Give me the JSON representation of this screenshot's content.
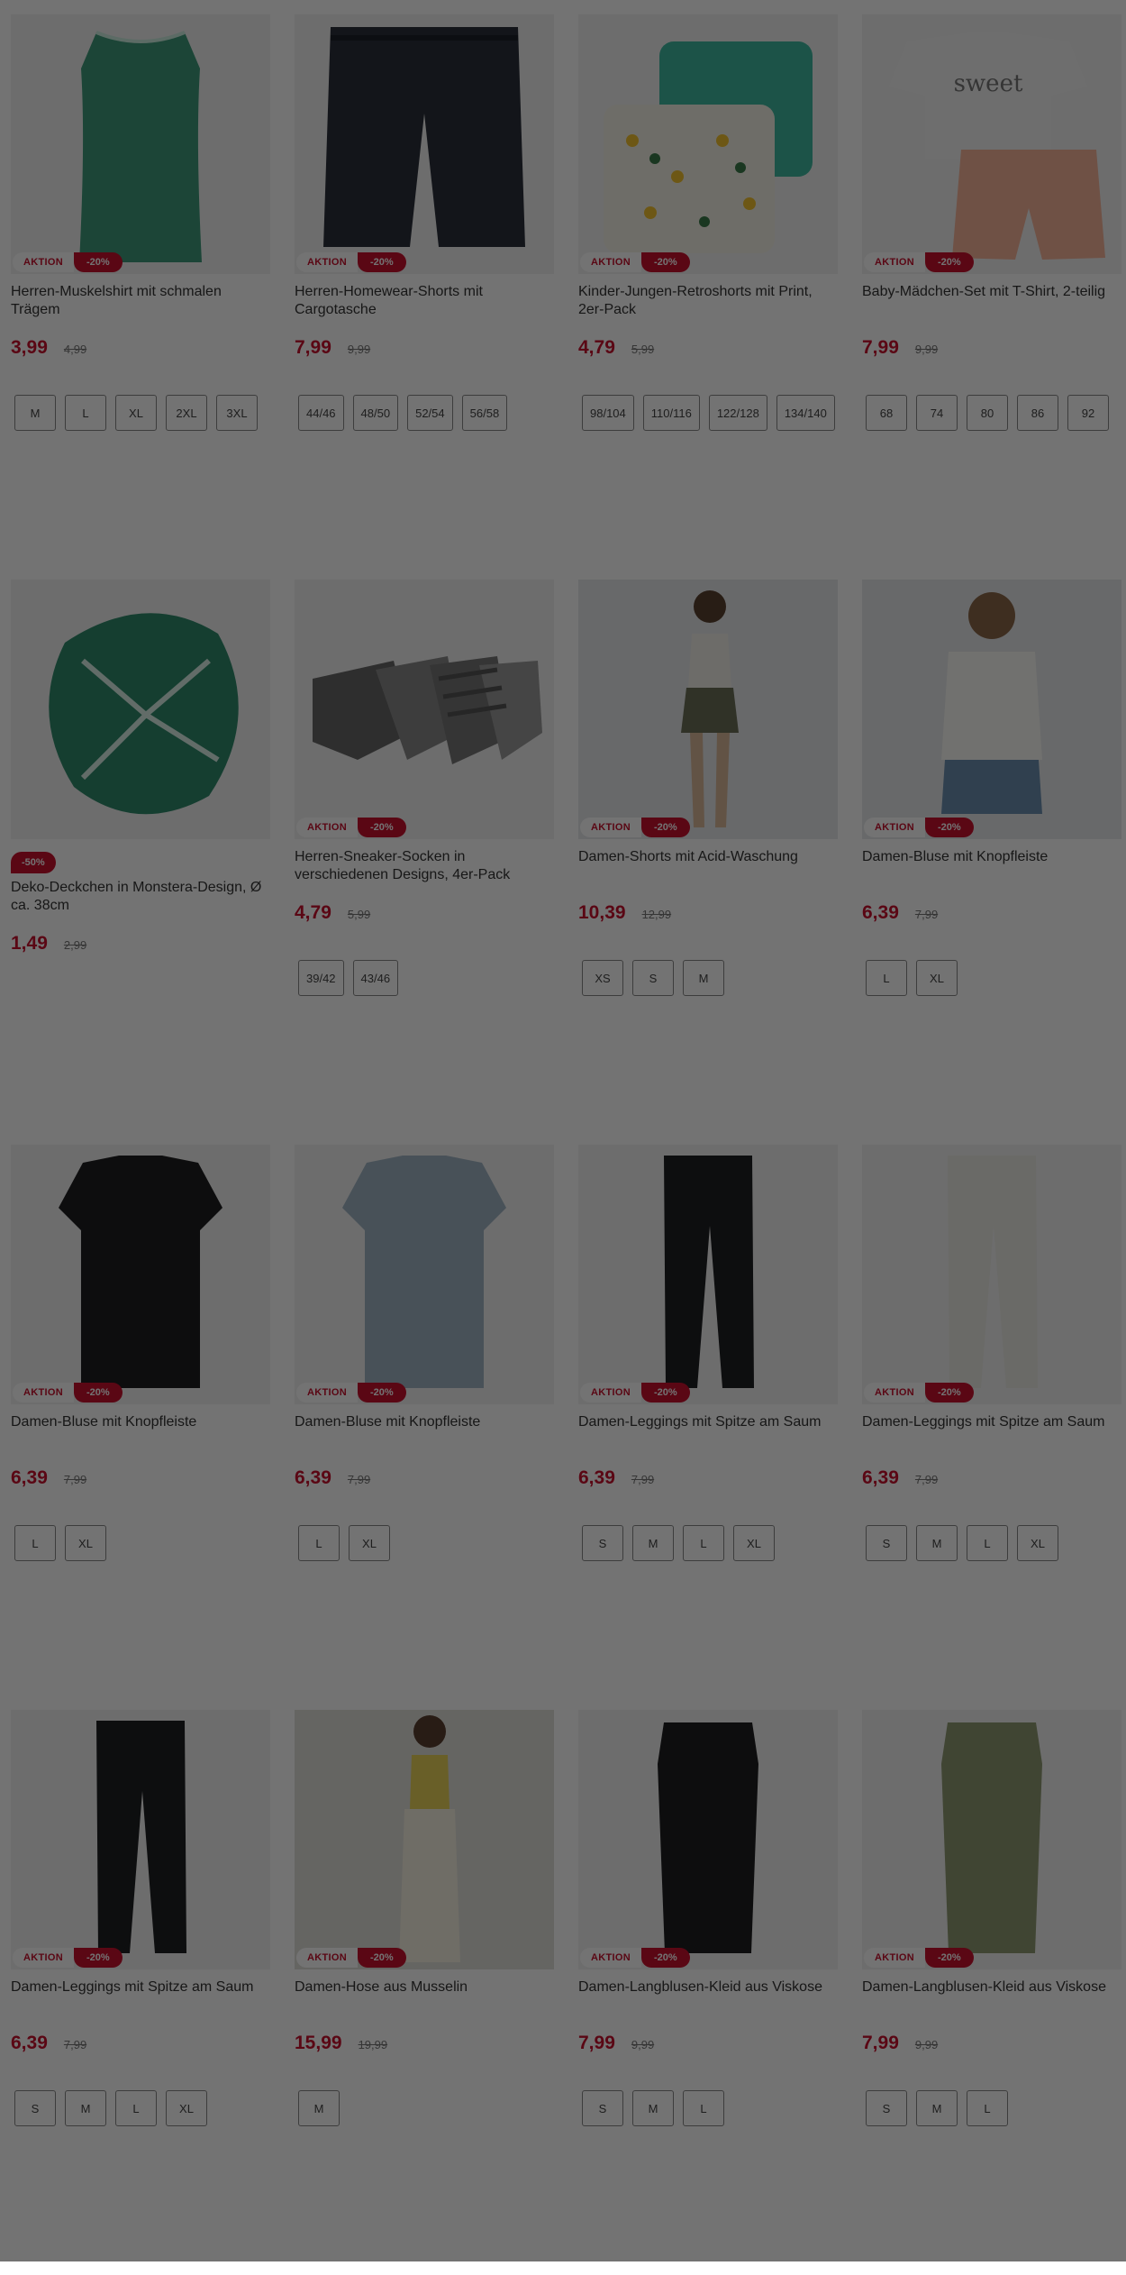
{
  "products": [
    {
      "title": "Herren-Muskelshirt mit schmalen Trägem",
      "aktion": "AKTION",
      "discount": "-20%",
      "price": "3,99",
      "old_price": "4,99",
      "sizes": [
        "M",
        "L",
        "XL",
        "2XL",
        "3XL"
      ],
      "image": "green-tank-top"
    },
    {
      "title": "Herren-Homewear-Shorts mit Cargotasche",
      "aktion": "AKTION",
      "discount": "-20%",
      "price": "7,99",
      "old_price": "9,99",
      "sizes": [
        "44/46",
        "48/50",
        "52/54",
        "56/58"
      ],
      "image": "navy-shorts"
    },
    {
      "title": "Kinder-Jungen-Retroshorts mit Print, 2er-Pack",
      "aktion": "AKTION",
      "discount": "-20%",
      "price": "4,79",
      "old_price": "5,99",
      "sizes": [
        "98/104",
        "110/116",
        "122/128",
        "134/140"
      ],
      "image": "kids-shorts-pack"
    },
    {
      "title": "Baby-Mädchen-Set mit T-Shirt, 2-teilig",
      "aktion": "AKTION",
      "discount": "-20%",
      "price": "7,99",
      "old_price": "9,99",
      "sizes": [
        "68",
        "74",
        "80",
        "86",
        "92"
      ],
      "image": "baby-set"
    },
    {
      "title": "Deko-Deckchen in Monstera-Design, Ø ca. 38cm",
      "aktion": "",
      "discount": "-50%",
      "price": "1,49",
      "old_price": "2,99",
      "sizes": [],
      "image": "monstera-doily"
    },
    {
      "title": "Herren-Sneaker-Socken in verschiedenen Designs, 4er-Pack",
      "aktion": "AKTION",
      "discount": "-20%",
      "price": "4,79",
      "old_price": "5,99",
      "sizes": [
        "39/42",
        "43/46"
      ],
      "image": "sneaker-socks"
    },
    {
      "title": "Damen-Shorts mit Acid-Waschung",
      "aktion": "AKTION",
      "discount": "-20%",
      "price": "10,39",
      "old_price": "12,99",
      "sizes": [
        "XS",
        "S",
        "M"
      ],
      "image": "model-shorts"
    },
    {
      "title": "Damen-Bluse mit Knopfleiste",
      "aktion": "AKTION",
      "discount": "-20%",
      "price": "6,39",
      "old_price": "7,99",
      "sizes": [
        "L",
        "XL"
      ],
      "image": "model-blouse"
    },
    {
      "title": "Damen-Bluse mit Knopfleiste",
      "aktion": "AKTION",
      "discount": "-20%",
      "price": "6,39",
      "old_price": "7,99",
      "sizes": [
        "L",
        "XL"
      ],
      "image": "black-blouse"
    },
    {
      "title": "Damen-Bluse mit Knopfleiste",
      "aktion": "AKTION",
      "discount": "-20%",
      "price": "6,39",
      "old_price": "7,99",
      "sizes": [
        "L",
        "XL"
      ],
      "image": "blue-blouse"
    },
    {
      "title": "Damen-Leggings mit Spitze am Saum",
      "aktion": "AKTION",
      "discount": "-20%",
      "price": "6,39",
      "old_price": "7,99",
      "sizes": [
        "S",
        "M",
        "L",
        "XL"
      ],
      "image": "black-leggings"
    },
    {
      "title": "Damen-Leggings mit Spitze am Saum",
      "aktion": "AKTION",
      "discount": "-20%",
      "price": "6,39",
      "old_price": "7,99",
      "sizes": [
        "S",
        "M",
        "L",
        "XL"
      ],
      "image": "white-leggings"
    },
    {
      "title": "Damen-Leggings mit Spitze am Saum",
      "aktion": "AKTION",
      "discount": "-20%",
      "price": "6,39",
      "old_price": "7,99",
      "sizes": [
        "S",
        "M",
        "L",
        "XL"
      ],
      "image": "black-leggings"
    },
    {
      "title": "Damen-Hose aus Musselin",
      "aktion": "AKTION",
      "discount": "-20%",
      "price": "15,99",
      "old_price": "19,99",
      "sizes": [
        "M"
      ],
      "image": "model-pants"
    },
    {
      "title": "Damen-Langblusen-Kleid aus Viskose",
      "aktion": "AKTION",
      "discount": "-20%",
      "price": "7,99",
      "old_price": "9,99",
      "sizes": [
        "S",
        "M",
        "L"
      ],
      "image": "black-dress"
    },
    {
      "title": "Damen-Langblusen-Kleid aus Viskose",
      "aktion": "AKTION",
      "discount": "-20%",
      "price": "7,99",
      "old_price": "9,99",
      "sizes": [
        "S",
        "M",
        "L"
      ],
      "image": "olive-dress"
    }
  ],
  "colors": {
    "accent": "#c8102e",
    "overlay": "rgba(0,0,0,0.55)"
  }
}
